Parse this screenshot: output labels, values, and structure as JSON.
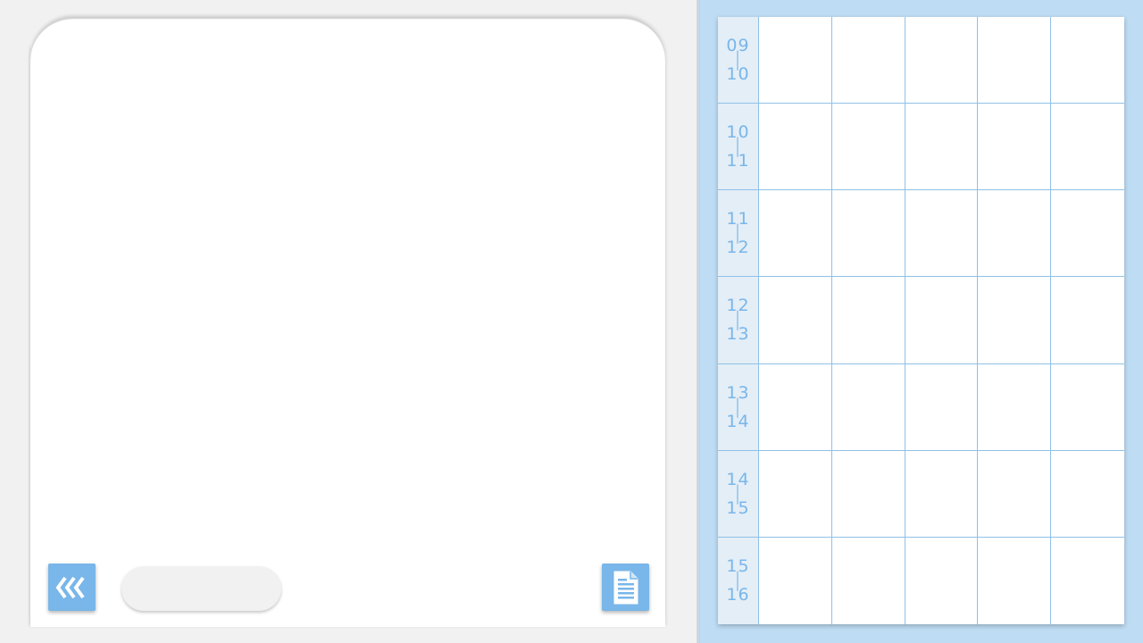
{
  "left_panel": {
    "back_button": {
      "icon": "chevrons-left-icon",
      "glyph": "««"
    },
    "name_field": {
      "value": ""
    },
    "notes_button": {
      "icon": "document-icon"
    }
  },
  "schedule": {
    "accent_color": "#79b6e9",
    "background_color": "#bedcf3",
    "columns": 5,
    "time_slots": [
      {
        "start": "09",
        "end": "10"
      },
      {
        "start": "10",
        "end": "11"
      },
      {
        "start": "11",
        "end": "12"
      },
      {
        "start": "12",
        "end": "13"
      },
      {
        "start": "13",
        "end": "14"
      },
      {
        "start": "14",
        "end": "15"
      },
      {
        "start": "15",
        "end": "16"
      }
    ],
    "separator": "|"
  }
}
